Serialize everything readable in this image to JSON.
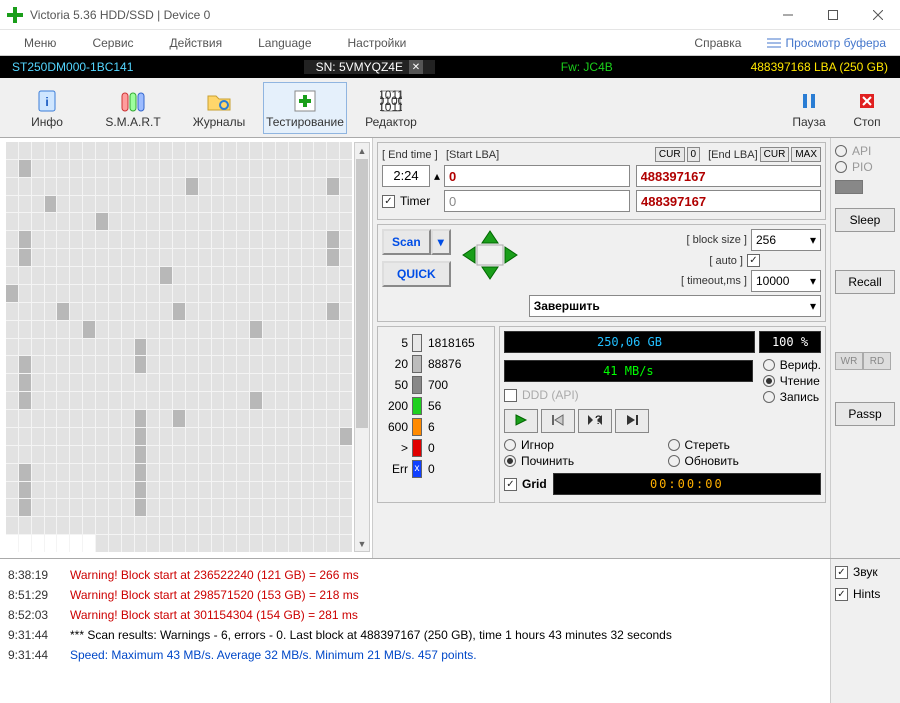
{
  "window": {
    "title": "Victoria 5.36 HDD/SSD | Device 0"
  },
  "menu": {
    "items": [
      "Меню",
      "Сервис",
      "Действия",
      "Language",
      "Настройки",
      "Справка"
    ],
    "buffer_view": "Просмотр буфера"
  },
  "infobar": {
    "model": "ST250DM000-1BC141",
    "sn": "SN: 5VMYQZ4E",
    "fw": "Fw: JC4B",
    "lba": "488397168 LBA (250 GB)"
  },
  "toolbar": {
    "info": "Инфо",
    "smart": "S.M.A.R.T",
    "journals": "Журналы",
    "testing": "Тестирование",
    "editor": "Редактор",
    "pause": "Пауза",
    "stop": "Стоп"
  },
  "scan": {
    "end_time_hdr": "[ End time ]",
    "start_lba_hdr": "[Start LBA]",
    "end_lba_hdr": "[End LBA]",
    "cur": "CUR",
    "zero": "0",
    "max": "MAX",
    "end_time": "2:24",
    "timer_label": "Timer",
    "start_lba": "0",
    "end_lba": "488397167",
    "start_lba2": "0",
    "end_lba2": "488397167",
    "scan_btn": "Scan",
    "quick_btn": "QUICK",
    "block_size_hdr": "[ block size ]",
    "auto_hdr": "[ auto ]",
    "timeout_hdr": "[ timeout,ms ]",
    "block_size": "256",
    "timeout": "10000",
    "action": "Завершить"
  },
  "legend": {
    "t5": {
      "label": "5",
      "count": "1818165"
    },
    "t20": {
      "label": "20",
      "count": "88876"
    },
    "t50": {
      "label": "50",
      "count": "700"
    },
    "t200": {
      "label": "200",
      "count": "56"
    },
    "t600": {
      "label": "600",
      "count": "6"
    },
    "tgt": {
      "label": ">",
      "count": "0"
    },
    "err": {
      "label": "Err",
      "count": "0"
    }
  },
  "status": {
    "size": "250,06 GB",
    "percent": "100   %",
    "speed": "41 MB/s",
    "ddd": "DDD (API)",
    "verify": "Вериф.",
    "read": "Чтение",
    "write": "Запись",
    "ignore": "Игнор",
    "erase": "Стереть",
    "fix": "Починить",
    "refresh": "Обновить",
    "grid": "Grid",
    "timer": "00:00:00"
  },
  "side": {
    "api": "API",
    "pio": "PIO",
    "sleep": "Sleep",
    "recall": "Recall",
    "wr": "WR",
    "rd": "RD",
    "passp": "Passp",
    "sound": "Звук",
    "hints": "Hints"
  },
  "log": [
    {
      "ts": "8:38:19",
      "cls": "warn",
      "txt": "Warning! Block start at 236522240 (121 GB)  = 266 ms"
    },
    {
      "ts": "8:51:29",
      "cls": "warn",
      "txt": "Warning! Block start at 298571520 (153 GB)  = 218 ms"
    },
    {
      "ts": "8:52:03",
      "cls": "warn",
      "txt": "Warning! Block start at 301154304 (154 GB)  = 281 ms"
    },
    {
      "ts": "9:31:44",
      "cls": "info",
      "txt": "*** Scan results: Warnings - 6, errors - 0. Last block at 488397167 (250 GB), time 1 hours 43 minutes 32 seconds"
    },
    {
      "ts": "9:31:44",
      "cls": "speed",
      "txt": "Speed: Maximum 43 MB/s. Average 32 MB/s. Minimum 21 MB/s. 457 points."
    }
  ],
  "map_dark_cells": [
    28,
    68,
    79,
    84,
    115,
    136,
    160,
    163,
    187,
    201,
    216,
    247,
    256,
    268,
    276,
    289,
    307,
    325,
    334,
    352,
    379,
    397,
    415,
    418,
    442,
    458,
    469,
    487,
    496,
    514,
    523,
    541,
    550
  ]
}
